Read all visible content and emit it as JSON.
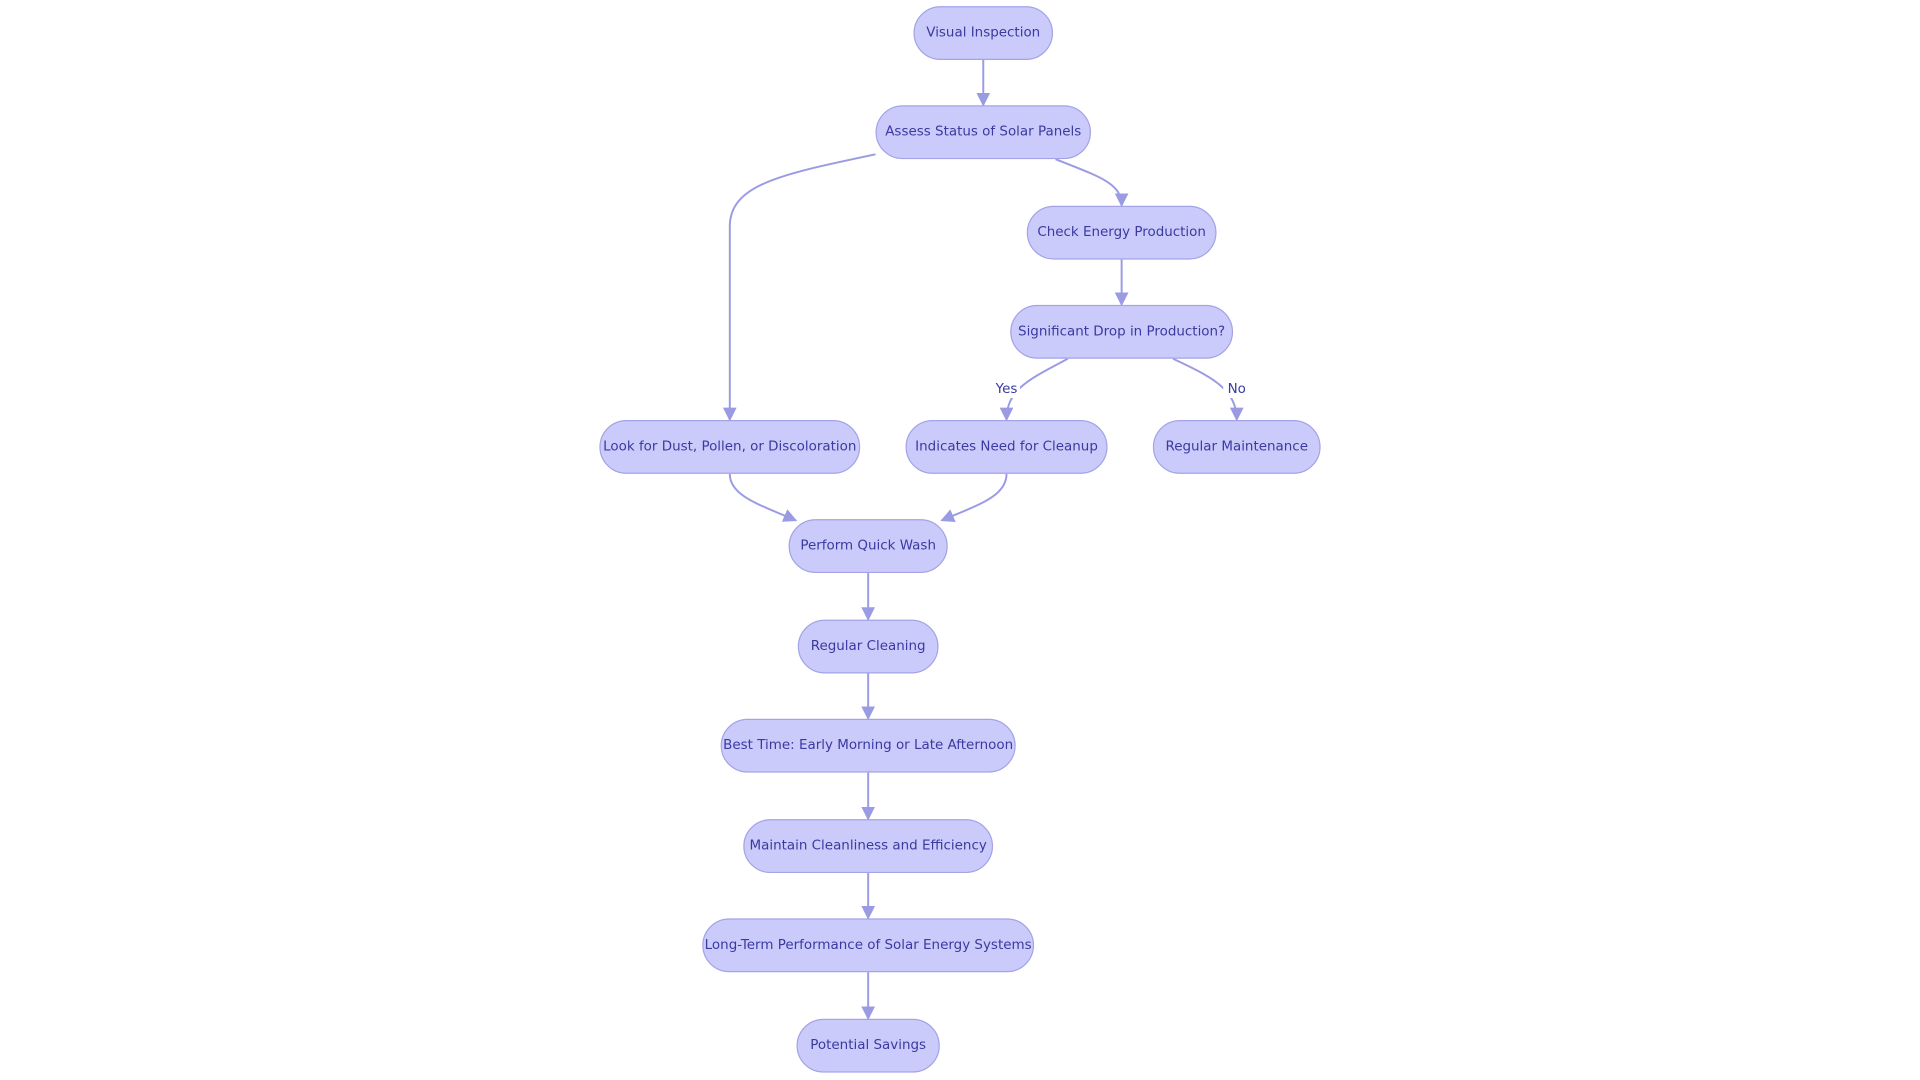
{
  "nodes": [
    {
      "id": "visual",
      "label": "Visual Inspection"
    },
    {
      "id": "assess",
      "label": "Assess Status of Solar Panels"
    },
    {
      "id": "check",
      "label": "Check Energy Production"
    },
    {
      "id": "drop",
      "label": "Significant Drop in Production?"
    },
    {
      "id": "look",
      "label": "Look for Dust, Pollen, or Discoloration"
    },
    {
      "id": "indicates",
      "label": "Indicates Need for Cleanup"
    },
    {
      "id": "maint",
      "label": "Regular Maintenance"
    },
    {
      "id": "wash",
      "label": "Perform Quick Wash"
    },
    {
      "id": "cleaning",
      "label": "Regular Cleaning"
    },
    {
      "id": "besttime",
      "label": "Best Time: Early Morning or Late Afternoon"
    },
    {
      "id": "maintain",
      "label": "Maintain Cleanliness and Efficiency"
    },
    {
      "id": "longterm",
      "label": "Long-Term Performance of Solar Energy Systems"
    },
    {
      "id": "savings",
      "label": "Potential Savings"
    }
  ],
  "edges": [
    {
      "from": "visual",
      "to": "assess",
      "label": ""
    },
    {
      "from": "assess",
      "to": "look",
      "label": ""
    },
    {
      "from": "assess",
      "to": "check",
      "label": ""
    },
    {
      "from": "check",
      "to": "drop",
      "label": ""
    },
    {
      "from": "drop",
      "to": "indicates",
      "label": "Yes"
    },
    {
      "from": "drop",
      "to": "maint",
      "label": "No"
    },
    {
      "from": "look",
      "to": "wash",
      "label": ""
    },
    {
      "from": "indicates",
      "to": "wash",
      "label": ""
    },
    {
      "from": "wash",
      "to": "cleaning",
      "label": ""
    },
    {
      "from": "cleaning",
      "to": "besttime",
      "label": ""
    },
    {
      "from": "besttime",
      "to": "maintain",
      "label": ""
    },
    {
      "from": "maintain",
      "to": "longterm",
      "label": ""
    },
    {
      "from": "longterm",
      "to": "savings",
      "label": ""
    }
  ],
  "colors": {
    "node_fill": "#cbcbfb",
    "node_stroke": "#a3a3e6",
    "edge": "#9b9be4",
    "text": "#3a3aa0"
  }
}
